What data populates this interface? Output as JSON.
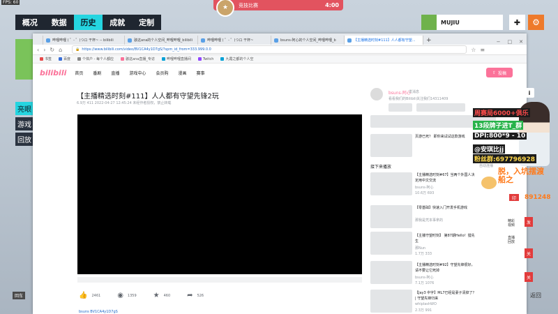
{
  "hud": {
    "fps": "FPS: 60",
    "tabs": [
      "概况",
      "数据",
      "历史",
      "成就",
      "定制"
    ],
    "active_tab": 2,
    "match_label": "竞技比赛",
    "match_time": "4:00",
    "username": "MUJIU",
    "side_tabs": [
      "亮眼",
      "游戏",
      "回放"
    ],
    "back_left": "回车",
    "back_right": "返回",
    "badge_right": "i"
  },
  "browser": {
    "tabs": [
      "哔哩哔哩 ( ゜- ゜)つロ 干杯~ -- bilibili",
      "骇这ana的个人空间_哔哩哔哩_bilibili",
      "哔哩哔哩 ( ゜- ゜)つロ 干杯~",
      "bsuns-阿心的个人空间_哔哩哔哩_b",
      "【主播精选时刻#111】人人都有守望..."
    ],
    "active_tab": 4,
    "new_tab": "+",
    "url": "https://www.bilibili.com/video/BV1CA4y1D7gS/?spm_id_from=333.999.0.0",
    "bookmarks": [
      "书签",
      "百度",
      "个体户 - 每个人都应",
      "骇这ana直播_专访",
      "哔哩哔哩直播间",
      "Twitch",
      "九霞之都的个人空"
    ]
  },
  "site": {
    "logo": "bilibili",
    "nav": [
      "首页",
      "番剧",
      "直播",
      "游戏中心",
      "会员购",
      "漫画",
      "赛事"
    ],
    "upload": "投稿"
  },
  "video": {
    "title": "【主播精选时刻#111】人人都有守望先锋2玩",
    "meta": "6.9万    411    2022-04-27 12:45:24    未经作者授权，禁止转载",
    "likes": "2461",
    "coins": "1359",
    "favs": "460",
    "shares": "526",
    "tag": "bsuns BV1CA4y1D7gS"
  },
  "uploader": {
    "name": "bsuns-阿心",
    "message": "发消息",
    "desc": "看看我们的Bilibili关注我们14311409"
  },
  "sidebar": {
    "ad_text": "页游已死？ 即你来试试这款游戏",
    "next_label": "接下来播放",
    "autoplay": "自动连播",
    "recs": [
      {
        "title": "【主播精选时刻#67】当两个外国人决定用中文交流",
        "up": "bsuns-阿心",
        "stats": "10.6万    693"
      },
      {
        "title": "【零基础】快速入门开发手机游戏",
        "up": "那我是凭本事拿的",
        "stats": ""
      },
      {
        "title": "【主播守望时刻】 第87期Hello！猎先生",
        "up": "那Nun",
        "stats": "1.7万    333"
      },
      {
        "title": "【主播精选时刻#92】守望先锋很好，请不要让它死掉",
        "up": "bsuns-阿心",
        "stats": "7.1万    1076"
      },
      {
        "title": "【Jay3 中字】ML7已经是妻子清掉了？ | 守望先锋归来",
        "up": "whiplashWO",
        "stats": "2.3万    991"
      }
    ]
  },
  "overlay": {
    "lines": [
      "周赛局6000+俱乐",
      "13段牌子进T_群",
      "DPI:800*9 - 10",
      "@安琪比jj",
      "粉丝群:697796928"
    ],
    "promo": "脱，入坑摆渡\n船之",
    "fans": "891248",
    "right_tags": [
      "发",
      "关",
      "关"
    ],
    "right_texts": [
      "精彩\n视频",
      "直播\n回放"
    ]
  }
}
